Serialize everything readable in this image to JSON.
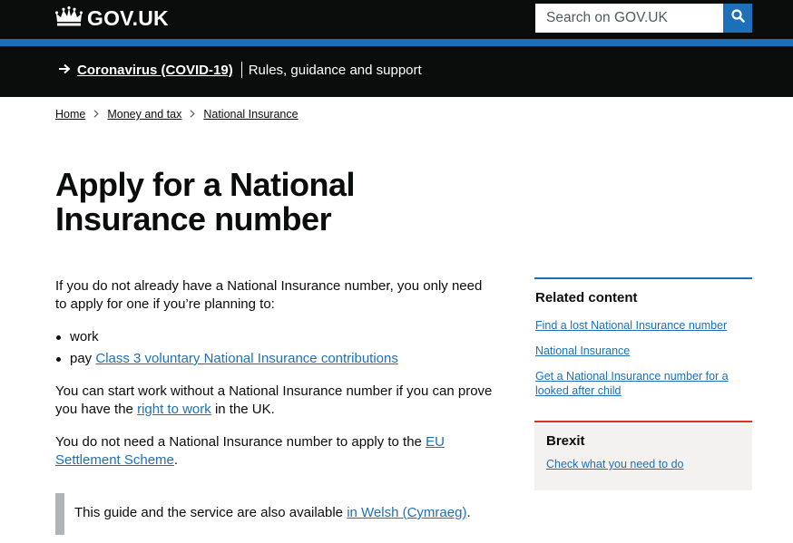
{
  "header": {
    "logo_text": "GOV.UK",
    "search_placeholder": "Search on GOV.UK"
  },
  "covid_banner": {
    "link_text": "Coronavirus (COVID-19)",
    "text": "Rules, guidance and support"
  },
  "breadcrumb": {
    "items": [
      "Home",
      "Money and tax",
      "National Insurance"
    ]
  },
  "page": {
    "title": "Apply for a National Insurance number",
    "intro": "If you do not already have a National Insurance number, you only need to apply for one if you’re planning to:",
    "list_item_1": "work",
    "list_item_2_prefix": "pay ",
    "list_item_2_link": "Class 3 voluntary National Insurance contributions",
    "para2_before": "You can start work without a National Insurance number if you can prove you have the ",
    "para2_link": "right to work",
    "para2_after": " in the UK.",
    "para3_before": "You do not need a National Insurance number to apply to the ",
    "para3_link": "EU Settlement Scheme",
    "para3_after": ".",
    "inset_before": "This guide and the service are also available ",
    "inset_link": "in Welsh (Cymraeg)",
    "inset_after": "."
  },
  "related": {
    "heading": "Related content",
    "links": [
      "Find a lost National Insurance number",
      "National Insurance",
      "Get a National Insurance number for a looked after child"
    ]
  },
  "brexit": {
    "title": "Brexit",
    "link": "Check what you need to do"
  },
  "colors": {
    "header_bg": "#0b0c0c",
    "brand_blue": "#1d70b8",
    "link": "#1d70b8",
    "brexit_accent": "#d4351c",
    "inset_bar": "#b1b4b6",
    "panel_bg": "#f3f2f1"
  },
  "icons": {
    "logo": "crown-icon",
    "search": "search-icon",
    "covid": "arrow-right-icon",
    "breadcrumb_separator": "chevron-right-icon"
  }
}
